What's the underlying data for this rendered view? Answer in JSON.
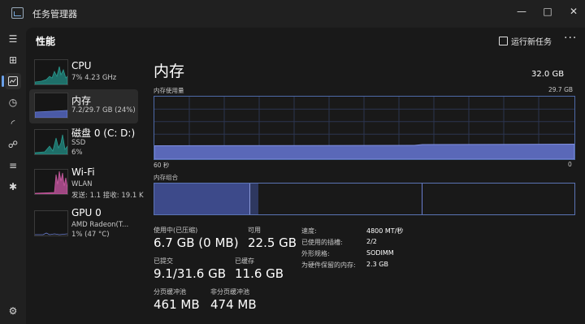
{
  "window": {
    "title": "任务管理器",
    "controls": {
      "minimize": "—",
      "maximize": "□",
      "close": "✕"
    }
  },
  "rail": {
    "icons": [
      "hamburger-icon",
      "processes-icon",
      "performance-icon",
      "history-icon",
      "startup-icon",
      "users-icon",
      "details-icon",
      "services-icon",
      "settings-icon"
    ],
    "active": "performance-icon"
  },
  "header": {
    "title": "性能",
    "run_task": "运行新任务",
    "more": "···"
  },
  "devices": [
    {
      "name": "CPU",
      "sub1": "7% 4.23 GHz",
      "sub2": "",
      "color": "#2a9a8e",
      "selected": false
    },
    {
      "name": "内存",
      "sub1": "7.2/29.7 GB (24%)",
      "sub2": "",
      "color": "#5c6fc2",
      "selected": true
    },
    {
      "name": "磁盘 0 (C: D:)",
      "sub1": "SSD",
      "sub2": "6%",
      "color": "#2a9a8e",
      "selected": false
    },
    {
      "name": "Wi-Fi",
      "sub1": "WLAN",
      "sub2": "发送: 1.1  接收: 19.1 K",
      "color": "#c75a9e",
      "selected": false
    },
    {
      "name": "GPU 0",
      "sub1": "AMD Radeon(T...",
      "sub2": "1% (47 °C)",
      "color": "#5c6fc2",
      "selected": false
    }
  ],
  "memory": {
    "title": "内存",
    "total": "32.0 GB",
    "usage_label": "内存使用量",
    "usage_max": "29.7 GB",
    "time_left": "60 秒",
    "time_right": "0",
    "usage_fraction": 0.24,
    "composition_label": "内存组合",
    "composition": {
      "in_use_fraction": 0.226,
      "modified_fraction": 0.02,
      "standby_fraction": 0.39
    },
    "stats": {
      "in_use_label": "使用中(已压缩)",
      "in_use": "6.7 GB (0 MB)",
      "available_label": "可用",
      "available": "22.5 GB",
      "committed_label": "已提交",
      "committed": "9.1/31.6 GB",
      "cached_label": "已缓存",
      "cached": "11.6 GB",
      "paged_label": "分页缓冲池",
      "paged": "461 MB",
      "nonpaged_label": "非分页缓冲池",
      "nonpaged": "474 MB"
    },
    "details": [
      {
        "label": "速度:",
        "value": "4800 MT/秒"
      },
      {
        "label": "已使用的插槽:",
        "value": "2/2"
      },
      {
        "label": "外形规格:",
        "value": "SODIMM"
      },
      {
        "label": "为硬件保留的内存:",
        "value": "2.3 GB"
      }
    ]
  }
}
